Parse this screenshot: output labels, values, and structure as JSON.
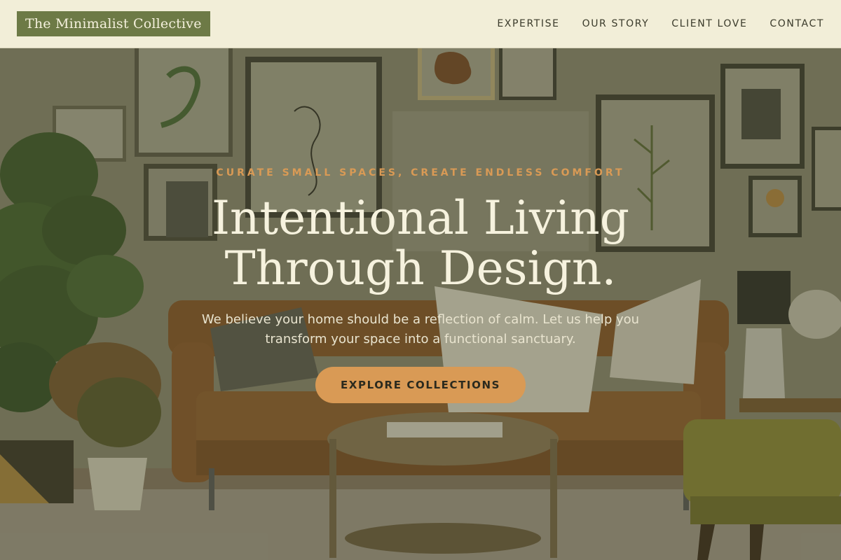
{
  "header": {
    "logo": "The Minimalist Collective",
    "nav": [
      {
        "label": "EXPERTISE"
      },
      {
        "label": "OUR STORY"
      },
      {
        "label": "CLIENT LOVE"
      },
      {
        "label": "CONTACT"
      }
    ]
  },
  "hero": {
    "tagline": "CURATE SMALL SPACES, CREATE ENDLESS COMFORT",
    "headline_line1": "Intentional Living",
    "headline_line2": "Through Design.",
    "subtext": "We believe your home should be a reflection of calm. Let us help you transform your space into a functional sanctuary.",
    "cta_label": "EXPLORE COLLECTIONS"
  },
  "colors": {
    "header_bg": "#f2eed8",
    "logo_bg": "#6d7a46",
    "accent": "#d99a55",
    "headline": "#f6f2de"
  }
}
